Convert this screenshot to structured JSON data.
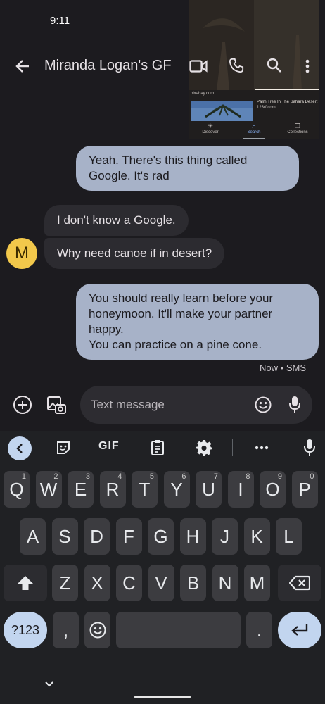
{
  "status": {
    "time": "9:11"
  },
  "header": {
    "title": "Miranda Logan's GF"
  },
  "preview": {
    "source1": "pixabay.com",
    "caption": "Palm Tree In The Sahara Desert St...",
    "source2": "123rf.com",
    "tabs": [
      "Discover",
      "Search",
      "Collections"
    ]
  },
  "messages": {
    "out1": "Yeah. There's this thing called Google. It's rad",
    "in1": "I don't know a Google.",
    "in2": "Why need canoe if in desert?",
    "out2_lines": [
      "You should really learn before your honeymoon. It'll make your partner happy.",
      "You can practice on a pine cone."
    ],
    "meta": "Now • SMS",
    "avatar_letter": "M"
  },
  "compose": {
    "placeholder": "Text message"
  },
  "keyboard": {
    "toolbar": {
      "gif": "GIF"
    },
    "row1": [
      {
        "k": "Q",
        "h": "1"
      },
      {
        "k": "W",
        "h": "2"
      },
      {
        "k": "E",
        "h": "3"
      },
      {
        "k": "R",
        "h": "4"
      },
      {
        "k": "T",
        "h": "5"
      },
      {
        "k": "Y",
        "h": "6"
      },
      {
        "k": "U",
        "h": "7"
      },
      {
        "k": "I",
        "h": "8"
      },
      {
        "k": "O",
        "h": "9"
      },
      {
        "k": "P",
        "h": "0"
      }
    ],
    "row2": [
      "A",
      "S",
      "D",
      "F",
      "G",
      "H",
      "J",
      "K",
      "L"
    ],
    "row3": [
      "Z",
      "X",
      "C",
      "V",
      "B",
      "N",
      "M"
    ],
    "symbols": "?123",
    "comma": ",",
    "period": "."
  }
}
